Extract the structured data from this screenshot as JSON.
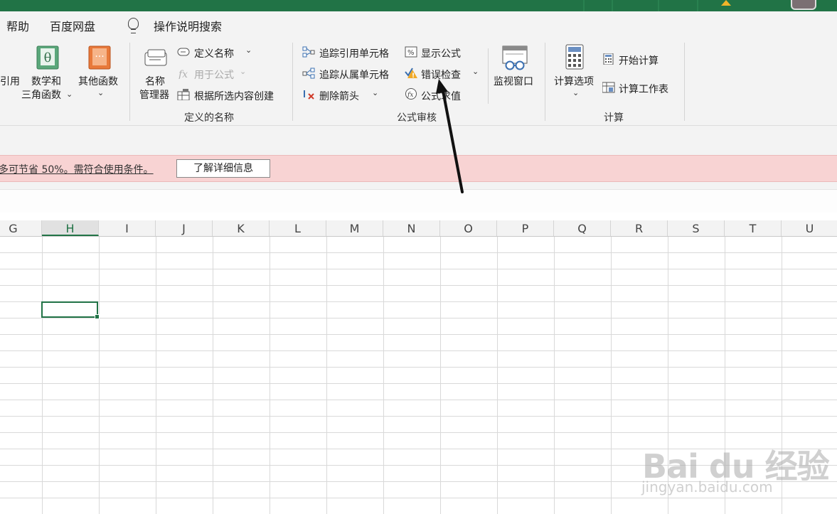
{
  "menu": {
    "help": "帮助",
    "baidu_netdisk": "百度网盘",
    "tell_me": "操作说明搜索"
  },
  "ribbon": {
    "function_library": {
      "lookup_partial": "引用",
      "math_trig_line1": "数学和",
      "math_trig_line2": "三角函数",
      "more_functions": "其他函数"
    },
    "defined_names": {
      "name_manager_line1": "名称",
      "name_manager_line2": "管理器",
      "define_name": "定义名称",
      "use_in_formula": "用于公式",
      "create_from_selection": "根据所选内容创建",
      "group_label": "定义的名称"
    },
    "formula_auditing": {
      "trace_precedents": "追踪引用单元格",
      "trace_dependents": "追踪从属单元格",
      "remove_arrows": "删除箭头",
      "show_formulas": "显示公式",
      "error_checking": "错误检查",
      "evaluate_formula": "公式求值",
      "watch_window": "监视窗口",
      "group_label": "公式审核"
    },
    "calculation": {
      "calc_options": "计算选项",
      "calc_now": "开始计算",
      "calc_sheet": "计算工作表",
      "group_label": "计算"
    }
  },
  "message_bar": {
    "text": "多可节省 50%。需符合使用条件。",
    "button": "了解详细信息"
  },
  "sheet": {
    "columns": [
      "G",
      "H",
      "I",
      "J",
      "K",
      "L",
      "M",
      "N",
      "O",
      "P",
      "Q",
      "R",
      "S",
      "T",
      "U"
    ],
    "selected_column": "H"
  },
  "watermark": {
    "brand": "Bai  du 经验",
    "url": "jingyan.baidu.com"
  },
  "colors": {
    "excel_green": "#217346",
    "message_bg": "#f8d3d3"
  }
}
